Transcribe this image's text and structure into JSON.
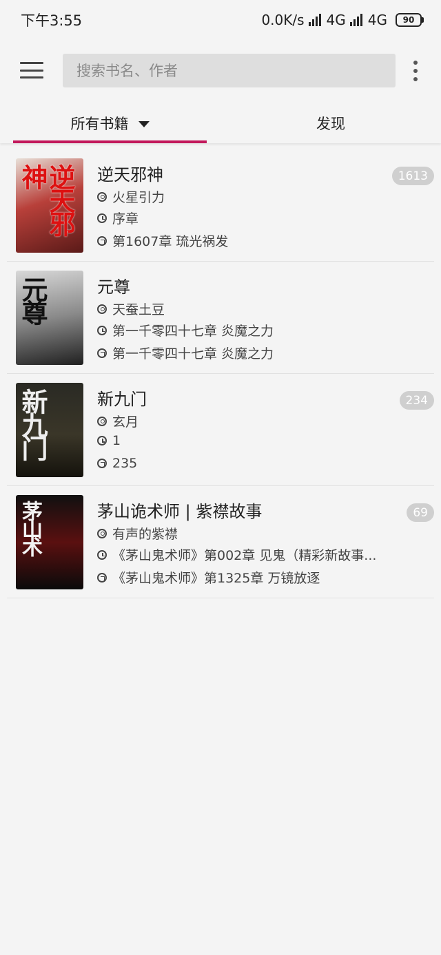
{
  "status_bar": {
    "time": "下午3:55",
    "net_speed": "0.0K/s",
    "signal1": "4G",
    "signal2": "4G",
    "battery": "90"
  },
  "toolbar": {
    "search_placeholder": "搜索书名、作者"
  },
  "tabs": {
    "all_books": "所有书籍",
    "discover": "发现"
  },
  "colors": {
    "accent": "#c2185b",
    "background": "#f4f4f4",
    "badge": "#cfcfcf"
  },
  "books": [
    {
      "title": "逆天邪神",
      "author": "火星引力",
      "last_read": "序章",
      "latest": "第1607章 琉光祸发",
      "unread": "1613",
      "cover_text": "逆天邪神"
    },
    {
      "title": "元尊",
      "author": "天蚕土豆",
      "last_read": "第一千零四十七章 炎魔之力",
      "latest": "第一千零四十七章 炎魔之力",
      "unread": "",
      "cover_text": "元尊"
    },
    {
      "title": "新九门",
      "author": "玄月",
      "last_read": "1",
      "latest": "235",
      "unread": "234",
      "cover_text": "新九门"
    },
    {
      "title": "茅山诡术师 | 紫襟故事",
      "author": "有声的紫襟",
      "last_read": "《茅山鬼术师》第002章 见鬼（精彩新故事...",
      "latest": "《茅山鬼术师》第1325章 万镜放逐",
      "unread": "69",
      "cover_text": "茅山术"
    }
  ]
}
